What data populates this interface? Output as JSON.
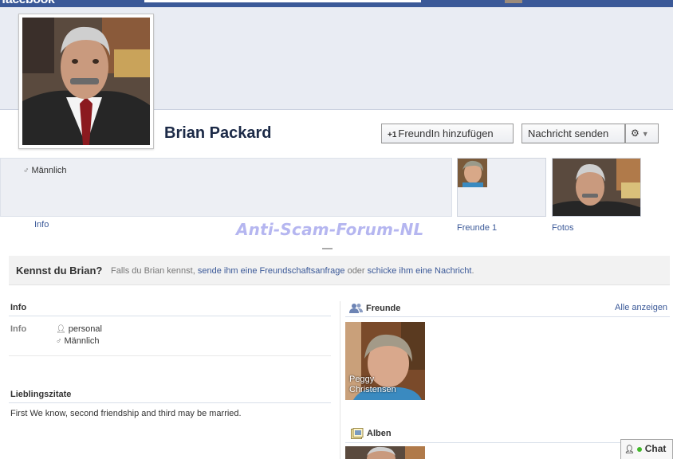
{
  "topbar": {
    "logo_text": "facebook"
  },
  "profile": {
    "name": "Brian Packard",
    "gender": "Männlich",
    "add_friend_label": "FreundIn hinzufügen",
    "add_friend_prefix": "+1",
    "message_label": "Nachricht senden",
    "gear_icon": "⚙",
    "caret_icon": "▼"
  },
  "tabs": {
    "info": "Info",
    "friends": "Freunde 1",
    "photos": "Fotos"
  },
  "watermark": "Anti-Scam-Forum-NL",
  "kennst": {
    "question": "Kennst du Brian?",
    "text1": "Falls du Brian kennst, ",
    "link1": "sende ihm eine Freundschaftsanfrage",
    "text2": " oder ",
    "link2": "schicke ihm eine Nachricht",
    "text3": "."
  },
  "info_section": {
    "title": "Info",
    "label": "Info",
    "items": [
      "personal",
      "Männlich"
    ]
  },
  "quotes_section": {
    "title": "Lieblingszitate",
    "text": "First We know, second friendship and third may be married."
  },
  "friends_section": {
    "title": "Freunde",
    "all_label": "Alle anzeigen",
    "friends": [
      {
        "first": "Peggy",
        "last": "Christensen"
      }
    ]
  },
  "albums_section": {
    "title": "Alben"
  },
  "chat": {
    "label": "Chat"
  },
  "colors": {
    "brand": "#3b5998",
    "link": "#3b5998",
    "watermark": "#b5b6f0",
    "online": "#42b72a"
  }
}
